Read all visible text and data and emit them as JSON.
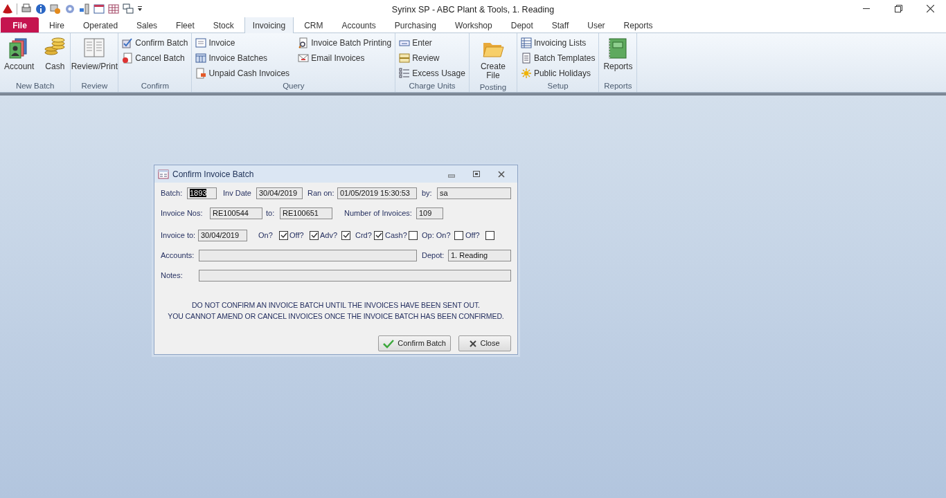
{
  "window": {
    "title": "Syrinx SP - ABC Plant & Tools, 1. Reading"
  },
  "tabs": [
    {
      "label": "File",
      "kind": "file",
      "selected": false
    },
    {
      "label": "Hire",
      "kind": "tab",
      "selected": false
    },
    {
      "label": "Operated",
      "kind": "tab",
      "selected": false
    },
    {
      "label": "Sales",
      "kind": "tab",
      "selected": false
    },
    {
      "label": "Fleet",
      "kind": "tab",
      "selected": false
    },
    {
      "label": "Stock",
      "kind": "tab",
      "selected": false
    },
    {
      "label": "Invoicing",
      "kind": "tab",
      "selected": true
    },
    {
      "label": "CRM",
      "kind": "tab",
      "selected": false
    },
    {
      "label": "Accounts",
      "kind": "tab",
      "selected": false
    },
    {
      "label": "Purchasing",
      "kind": "tab",
      "selected": false
    },
    {
      "label": "Workshop",
      "kind": "tab",
      "selected": false
    },
    {
      "label": "Depot",
      "kind": "tab",
      "selected": false
    },
    {
      "label": "Staff",
      "kind": "tab",
      "selected": false
    },
    {
      "label": "User",
      "kind": "tab",
      "selected": false
    },
    {
      "label": "Reports",
      "kind": "tab",
      "selected": false
    }
  ],
  "ribbon": {
    "groups": [
      {
        "label": "New Batch",
        "items": [
          {
            "label": "Account",
            "kind": "large"
          },
          {
            "label": "Cash",
            "kind": "large"
          }
        ]
      },
      {
        "label": "Review",
        "items": [
          {
            "label": "Review/Print",
            "kind": "large"
          }
        ]
      },
      {
        "label": "Confirm",
        "items": [
          {
            "label": "Confirm Batch",
            "kind": "small"
          },
          {
            "label": "Cancel Batch",
            "kind": "small"
          }
        ]
      },
      {
        "label": "Query",
        "items": [
          {
            "label": "Invoice",
            "kind": "small"
          },
          {
            "label": "Invoice Batches",
            "kind": "small"
          },
          {
            "label": "Unpaid Cash Invoices",
            "kind": "small"
          },
          {
            "label": "Invoice Batch Printing",
            "kind": "small"
          },
          {
            "label": "Email Invoices",
            "kind": "small"
          }
        ]
      },
      {
        "label": "Charge Units",
        "items": [
          {
            "label": "Enter",
            "kind": "small"
          },
          {
            "label": "Review",
            "kind": "small"
          },
          {
            "label": "Excess Usage",
            "kind": "small"
          }
        ]
      },
      {
        "label": "Posting",
        "items": [
          {
            "label": "Create File",
            "kind": "large"
          }
        ]
      },
      {
        "label": "Setup",
        "items": [
          {
            "label": "Invoicing Lists",
            "kind": "small"
          },
          {
            "label": "Batch Templates",
            "kind": "small"
          },
          {
            "label": "Public Holidays",
            "kind": "small"
          }
        ]
      },
      {
        "label": "Reports",
        "items": [
          {
            "label": "Reports",
            "kind": "large"
          }
        ]
      }
    ]
  },
  "dialog": {
    "title": "Confirm Invoice Batch",
    "rows": [
      {
        "entries": [
          {
            "kind": "field",
            "label": "Batch:",
            "value": "1893",
            "text_selected": true
          },
          {
            "kind": "field",
            "label": "Inv Date",
            "value": "30/04/2019"
          },
          {
            "kind": "field",
            "label": "Ran on:",
            "value": "01/05/2019 15:30:53"
          },
          {
            "kind": "field",
            "label": "by:",
            "value": "sa"
          }
        ]
      },
      {
        "entries": [
          {
            "kind": "field",
            "label": "Invoice Nos:",
            "value": "RE100544"
          },
          {
            "kind": "field",
            "label": "to:",
            "value": "RE100651"
          },
          {
            "kind": "field",
            "label": "Number of Invoices:",
            "value": "109"
          }
        ]
      },
      {
        "entries": [
          {
            "kind": "field",
            "label": "Invoice to:",
            "value": "30/04/2019"
          },
          {
            "kind": "check",
            "label": "On?",
            "checked": true
          },
          {
            "kind": "check",
            "label": "Off?",
            "checked": true
          },
          {
            "kind": "check",
            "label": "Adv?",
            "checked": true
          },
          {
            "kind": "check",
            "label": "Crd?",
            "checked": true
          },
          {
            "kind": "check",
            "label": "Cash?",
            "checked": false
          },
          {
            "kind": "check",
            "label": "Op: On?",
            "checked": false
          },
          {
            "kind": "check",
            "label": "Off?",
            "checked": false
          }
        ]
      },
      {
        "entries": [
          {
            "kind": "field",
            "label": "Accounts:"
          },
          {
            "kind": "field",
            "label": "Depot:",
            "value": "1. Reading"
          }
        ]
      },
      {
        "entries": [
          {
            "kind": "field",
            "label": "Notes:"
          }
        ]
      }
    ],
    "message": [
      "DO NOT CONFIRM AN INVOICE BATCH UNTIL THE INVOICES HAVE BEEN SENT OUT.",
      "YOU CANNOT AMEND OR CANCEL INVOICES ONCE THE INVOICE BATCH HAS BEEN CONFIRMED."
    ],
    "buttons": [
      {
        "label": "Confirm Batch",
        "kind": "confirm"
      },
      {
        "label": "Close",
        "kind": "close"
      }
    ]
  }
}
